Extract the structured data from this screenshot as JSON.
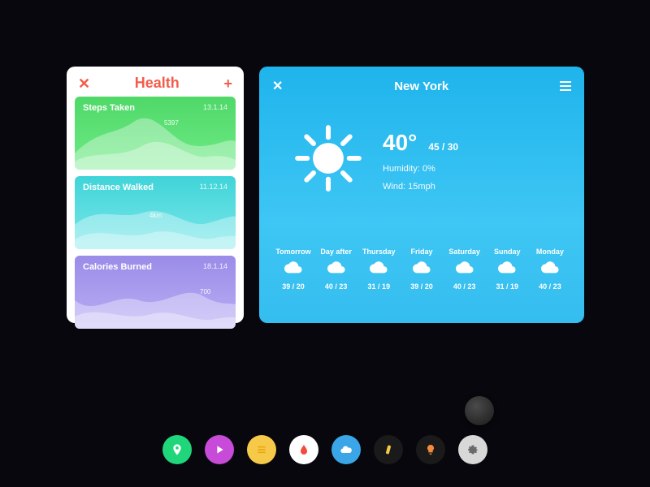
{
  "health": {
    "title": "Health",
    "metrics": [
      {
        "label": "Steps Taken",
        "date": "13.1.14",
        "value": "5397"
      },
      {
        "label": "Distance Walked",
        "date": "11.12.14",
        "value": "4km"
      },
      {
        "label": "Calories Burned",
        "date": "18.1.14",
        "value": "700"
      }
    ]
  },
  "weather": {
    "city": "New York",
    "temp": "40°",
    "range": "45 / 30",
    "humidity": "Humidity: 0%",
    "wind": "Wind: 15mph",
    "forecast": [
      {
        "label": "Tomorrow",
        "temp": "39 / 20"
      },
      {
        "label": "Day after",
        "temp": "40 / 23"
      },
      {
        "label": "Thursday",
        "temp": "31 / 19"
      },
      {
        "label": "Friday",
        "temp": "39 / 20"
      },
      {
        "label": "Saturday",
        "temp": "40 / 23"
      },
      {
        "label": "Sunday",
        "temp": "31 / 19"
      },
      {
        "label": "Monday",
        "temp": "40 / 23"
      }
    ]
  },
  "chart_data": [
    {
      "type": "area",
      "title": "Steps Taken",
      "values": [
        5397
      ],
      "annotation": "5397"
    },
    {
      "type": "area",
      "title": "Distance Walked",
      "values": [
        4
      ],
      "unit": "km",
      "annotation": "4km"
    },
    {
      "type": "area",
      "title": "Calories Burned",
      "values": [
        700
      ],
      "annotation": "700"
    }
  ]
}
